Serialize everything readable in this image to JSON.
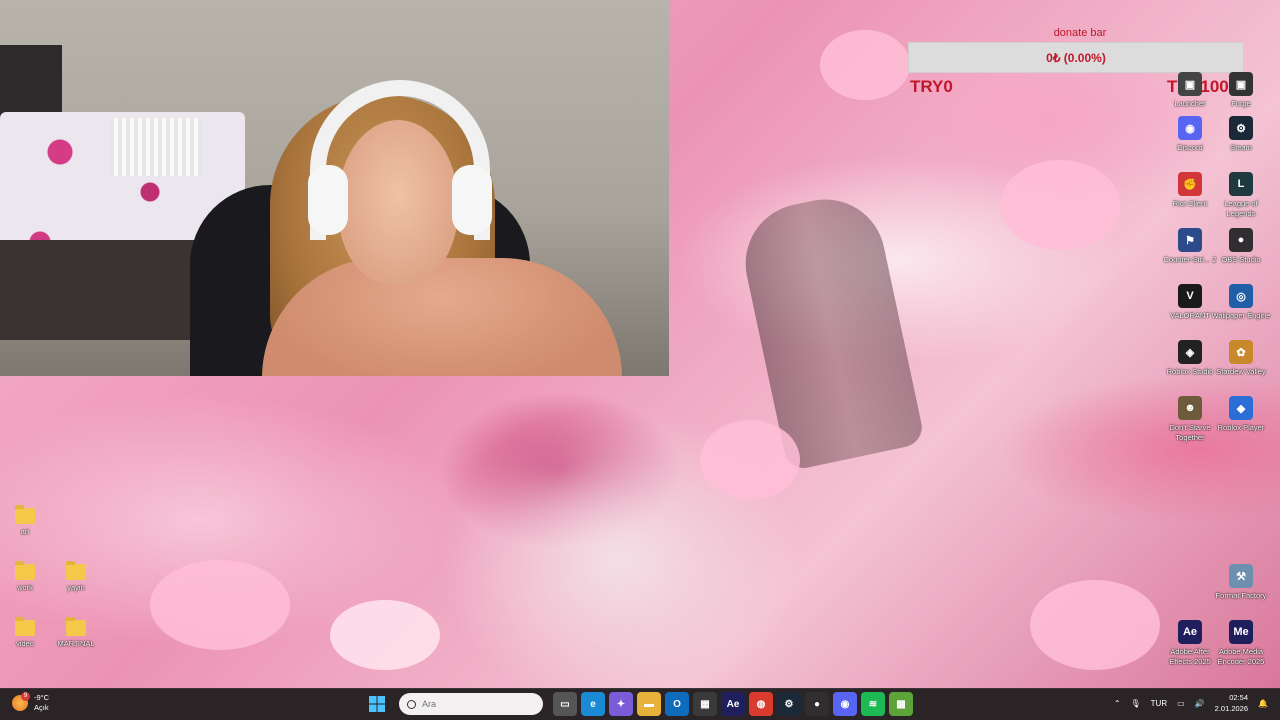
{
  "donate": {
    "title": "donate bar",
    "value": "0₺ (0.00%)",
    "min_label": "TRY0",
    "max_label": "TRY1000",
    "progress": 0
  },
  "desktop_left": [
    {
      "name": "folder-art",
      "label": "art"
    },
    {
      "name": "folder-work",
      "label": "work"
    },
    {
      "name": "folder-yayin",
      "label": "yayin"
    },
    {
      "name": "folder-video",
      "label": "video"
    },
    {
      "name": "folder-marjinal",
      "label": "MARJINAL"
    }
  ],
  "desktop_right": [
    {
      "label": "Launcher",
      "icon": "launcher-icon",
      "color": "#444444",
      "glyph": "▣"
    },
    {
      "label": "Forge",
      "icon": "forge-icon",
      "color": "#333333",
      "glyph": "▣"
    },
    {
      "label": "Discord",
      "icon": "discord-icon",
      "color": "#5865f2",
      "glyph": "◉"
    },
    {
      "label": "Steam",
      "icon": "steam-icon",
      "color": "#1b2838",
      "glyph": "⚙"
    },
    {
      "label": "Riot Client",
      "icon": "riot-client-icon",
      "color": "#d13639",
      "glyph": "✊"
    },
    {
      "label": "League of Legends",
      "icon": "league-icon",
      "color": "#1e3a3f",
      "glyph": "L"
    },
    {
      "label": "Counter-Stri... 2",
      "icon": "counter-strike-icon",
      "color": "#2d4a8a",
      "glyph": "⚑"
    },
    {
      "label": "OBS Studio",
      "icon": "obs-icon",
      "color": "#302e31",
      "glyph": "●"
    },
    {
      "label": "VALORANT",
      "icon": "valorant-icon",
      "color": "#1a1a1a",
      "glyph": "V"
    },
    {
      "label": "Wallpaper Engine",
      "icon": "wallpaper-engine-icon",
      "color": "#1f5fa8",
      "glyph": "◎"
    },
    {
      "label": "Roblox Studio",
      "icon": "roblox-studio-icon",
      "color": "#222222",
      "glyph": "◈"
    },
    {
      "label": "Stardew Valley",
      "icon": "stardew-icon",
      "color": "#c8892c",
      "glyph": "✿"
    },
    {
      "label": "Don't Starve Together",
      "icon": "dont-starve-icon",
      "color": "#6e5b3c",
      "glyph": "☻"
    },
    {
      "label": "Roblox Player",
      "icon": "roblox-player-icon",
      "color": "#2b6fd6",
      "glyph": "◆"
    },
    {
      "label": "Format Factory",
      "icon": "format-factory-icon",
      "color": "#6f8fae",
      "glyph": "⚒"
    },
    {
      "label": "Adobe After Effects 2025",
      "icon": "after-effects-icon",
      "color": "#1f1f5e",
      "glyph": "Ae"
    },
    {
      "label": "Adobe Media Encoder 2025",
      "icon": "media-encoder-icon",
      "color": "#1f1f5e",
      "glyph": "Me"
    }
  ],
  "taskbar": {
    "weather_temp": "-9°C",
    "weather_desc": "Açık",
    "weather_badge": "9",
    "search_placeholder": "Ara",
    "apps": [
      {
        "name": "task-view-icon",
        "color": "#555555",
        "glyph": "▭"
      },
      {
        "name": "edge-icon",
        "color": "#1a8ad4",
        "glyph": "e"
      },
      {
        "name": "copilot-icon",
        "color": "#7b5cd6",
        "glyph": "✦"
      },
      {
        "name": "file-explorer-icon",
        "color": "#e8b23a",
        "glyph": "▬"
      },
      {
        "name": "outlook-icon",
        "color": "#0f6cbd",
        "glyph": "O"
      },
      {
        "name": "store-icon",
        "color": "#3a3a3a",
        "glyph": "▦"
      },
      {
        "name": "after-effects-taskbar-icon",
        "color": "#1f1f5e",
        "glyph": "Ae"
      },
      {
        "name": "chrome-icon",
        "color": "#d93b2f",
        "glyph": "◍"
      },
      {
        "name": "steam-taskbar-icon",
        "color": "#1b2838",
        "glyph": "⚙"
      },
      {
        "name": "obs-taskbar-icon",
        "color": "#302e31",
        "glyph": "●"
      },
      {
        "name": "discord-taskbar-icon",
        "color": "#5865f2",
        "glyph": "◉"
      },
      {
        "name": "spotify-icon",
        "color": "#1db954",
        "glyph": "≋"
      },
      {
        "name": "minecraft-icon",
        "color": "#5ca33a",
        "glyph": "▩"
      }
    ],
    "language": "TUR",
    "time": "02:54",
    "date": "2.01.2026"
  }
}
